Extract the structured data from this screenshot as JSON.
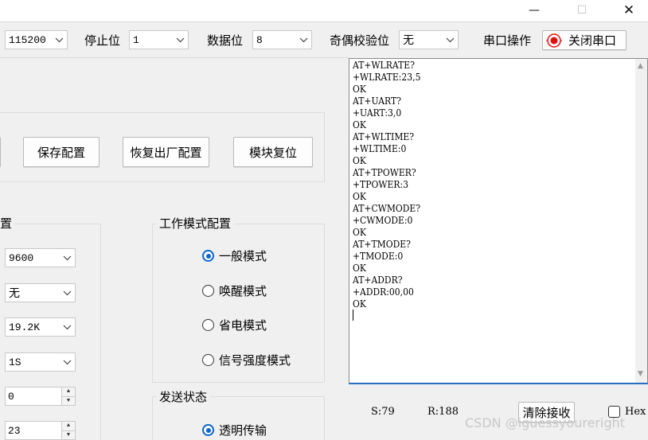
{
  "window": {
    "minimize_glyph": "—",
    "maximize_glyph": "☐",
    "close_glyph": "✕"
  },
  "toolbar": {
    "baud_value": "115200",
    "stop_bits_label": "停止位",
    "stop_bits_value": "1",
    "data_bits_label": "数据位",
    "data_bits_value": "8",
    "parity_label": "奇偶校验位",
    "parity_value": "无",
    "serial_op_label": "串口操作",
    "close_port_label": "关闭串口"
  },
  "config_buttons": {
    "save": "保存配置",
    "restore": "恢复出厂配置",
    "reset": "模块复位"
  },
  "params_group": {
    "title_fragment": "置",
    "fields": [
      "9600",
      "无",
      "19.2K",
      "1S"
    ],
    "spin_values": [
      "0",
      "23"
    ]
  },
  "mode_group": {
    "title": "工作模式配置",
    "options": [
      "一般模式",
      "唤醒模式",
      "省电模式",
      "信号强度模式"
    ],
    "selected_index": 0
  },
  "send_group": {
    "title": "发送状态",
    "option": "透明传输"
  },
  "terminal": {
    "text": "AT+WLRATE?\n+WLRATE:23,5\nOK\nAT+UART?\n+UART:3,0\nOK\nAT+WLTIME?\n+WLTIME:0\nOK\nAT+TPOWER?\n+TPOWER:3\nOK\nAT+CWMODE?\n+CWMODE:0\nOK\nAT+TMODE?\n+TMODE:0\nOK\nAT+ADDR?\n+ADDR:00,00\nOK"
  },
  "status": {
    "send_count": "S:79",
    "recv_count": "R:188",
    "clear_button": "清除接收",
    "hex_label": "Hex"
  },
  "watermark": "CSDN @iguessyoureright",
  "colors": {
    "accent": "#0a64c8",
    "record_red": "#e01010"
  }
}
